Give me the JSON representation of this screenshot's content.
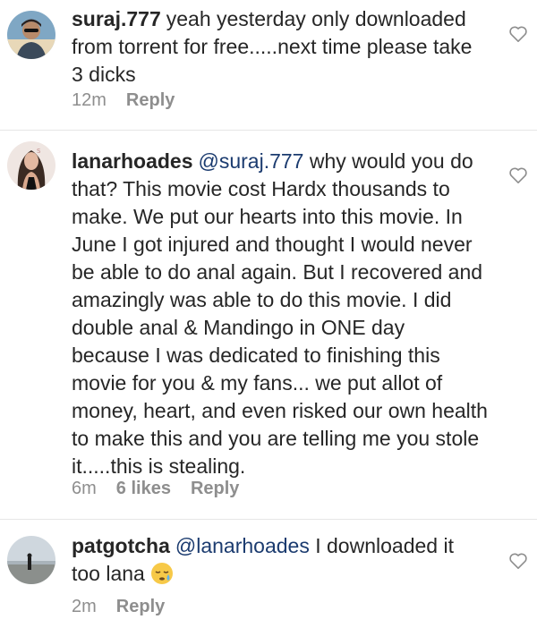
{
  "comments": [
    {
      "username": "suraj.777",
      "mention": "",
      "text": "yeah yesterday only downloaded from torrent for free.....next time please take 3 dicks",
      "time": "12m",
      "likes": "",
      "reply_label": "Reply",
      "avatar_icon": "profile-photo-man"
    },
    {
      "username": "lanarhoades",
      "mention": "@suraj.777",
      "text": "why would you do that? This movie cost Hardx thousands to make. We put our hearts into this movie. In June I got injured and thought I would never be able to do anal again. But I recovered and amazingly was able to do this movie. I did double anal & Mandingo in ONE day because I was dedicated to finishing this movie for you & my fans... we put allot of money, heart, and even risked our own health to make this and you are telling me you stole it.....this is stealing.",
      "time": "6m",
      "likes": "6 likes",
      "reply_label": "Reply",
      "avatar_icon": "profile-photo-woman"
    },
    {
      "username": "patgotcha",
      "mention": "@lanarhoades",
      "text": "I downloaded it too lana",
      "time": "2m",
      "likes": "",
      "reply_label": "Reply",
      "avatar_icon": "profile-photo-beach",
      "emoji_icon": "sleepy-face-emoji"
    }
  ],
  "icons": {
    "like": "heart-outline-icon"
  },
  "colors": {
    "mention": "#1b3b6f",
    "meta": "#8e8e8e",
    "text": "#262626"
  }
}
